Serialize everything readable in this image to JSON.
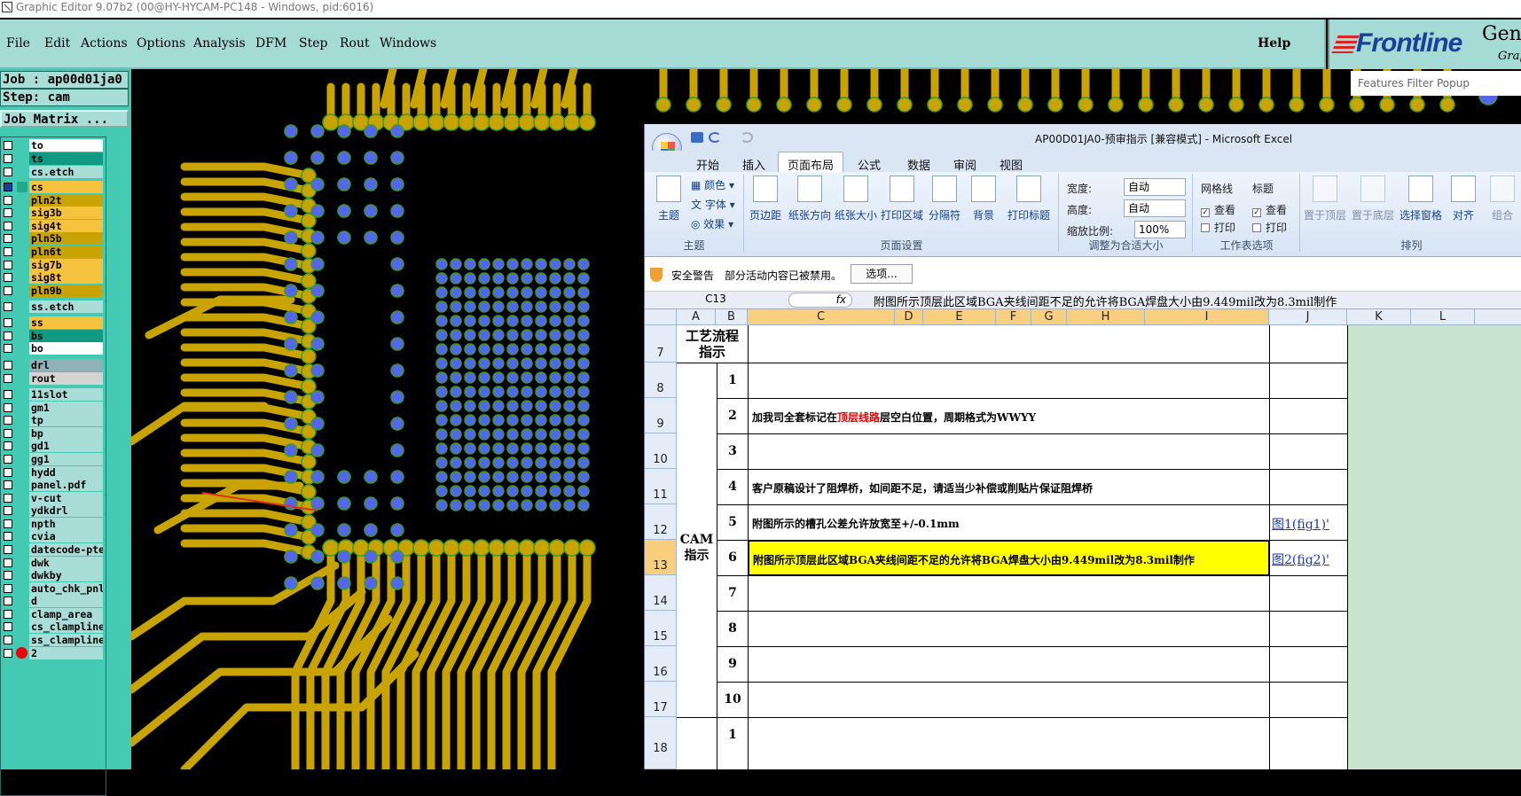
{
  "window": {
    "title": "Graphic Editor 9.07b2 (00@HY-HYCAM-PC148 - Windows, pid:6016)"
  },
  "menu": {
    "items": [
      "File",
      "Edit",
      "Actions",
      "Options",
      "Analysis",
      "DFM",
      "Step",
      "Rout",
      "Windows"
    ],
    "help": "Help"
  },
  "logo": {
    "brand": "Frontline",
    "product": "Genesis",
    "sub": "Graphic"
  },
  "job": {
    "job_label": "Job : ap00d01ja0",
    "step_label": "Step: cam",
    "matrix_button": "Job Matrix ..."
  },
  "layers": [
    {
      "name": "to",
      "color": "#ffffff",
      "checked": false
    },
    {
      "name": "ts",
      "color": "#109a83",
      "checked": false
    },
    {
      "name": "cs.etch",
      "color": "#a9ddd7",
      "checked": false
    },
    {
      "name": "cs",
      "color": "#f6c33e",
      "checked": true
    },
    {
      "name": "pln2t",
      "color": "#c9a300",
      "checked": false
    },
    {
      "name": "sig3b",
      "color": "#f6c33e",
      "checked": false
    },
    {
      "name": "sig4t",
      "color": "#f6c33e",
      "checked": false
    },
    {
      "name": "pln5b",
      "color": "#c9a300",
      "checked": false
    },
    {
      "name": "pln6t",
      "color": "#c9a300",
      "checked": false
    },
    {
      "name": "sig7b",
      "color": "#f6c33e",
      "checked": false
    },
    {
      "name": "sig8t",
      "color": "#f6c33e",
      "checked": false
    },
    {
      "name": "pln9b",
      "color": "#c9a300",
      "checked": false
    },
    {
      "name": "ss.etch",
      "color": "#a9ddd7",
      "checked": false
    },
    {
      "name": "ss",
      "color": "#f6c33e",
      "checked": false
    },
    {
      "name": "bs",
      "color": "#109a83",
      "checked": false
    },
    {
      "name": "bo",
      "color": "#ffffff",
      "checked": false
    },
    {
      "name": "drl",
      "color": "#8fb1b7",
      "checked": false
    },
    {
      "name": "rout",
      "color": "#d4d4d4",
      "checked": false
    },
    {
      "name": "11slot",
      "color": "#a9ddd7",
      "checked": false
    },
    {
      "name": "gm1",
      "color": "#a9ddd7",
      "checked": false
    },
    {
      "name": "tp",
      "color": "#a9ddd7",
      "checked": false
    },
    {
      "name": "bp",
      "color": "#a9ddd7",
      "checked": false
    },
    {
      "name": "gd1",
      "color": "#a9ddd7",
      "checked": false
    },
    {
      "name": "gg1",
      "color": "#a9ddd7",
      "checked": false
    },
    {
      "name": "hydd",
      "color": "#a9ddd7",
      "checked": false
    },
    {
      "name": "panel.pdf",
      "color": "#a9ddd7",
      "checked": false
    },
    {
      "name": "v-cut",
      "color": "#a9ddd7",
      "checked": false
    },
    {
      "name": "ydkdrl",
      "color": "#a9ddd7",
      "checked": false
    },
    {
      "name": "npth",
      "color": "#a9ddd7",
      "checked": false
    },
    {
      "name": "cvia",
      "color": "#a9ddd7",
      "checked": false
    },
    {
      "name": "datecode-pte",
      "color": "#a9ddd7",
      "checked": false
    },
    {
      "name": "dwk",
      "color": "#a9ddd7",
      "checked": false
    },
    {
      "name": "dwkby",
      "color": "#a9ddd7",
      "checked": false
    },
    {
      "name": "auto_chk_pnl",
      "color": "#a9ddd7",
      "checked": false
    },
    {
      "name": "d",
      "color": "#a9ddd7",
      "checked": false
    },
    {
      "name": "clamp_area",
      "color": "#a9ddd7",
      "checked": false
    },
    {
      "name": "cs_clampline",
      "color": "#a9ddd7",
      "checked": false
    },
    {
      "name": "ss_clampline",
      "color": "#a9ddd7",
      "checked": false
    },
    {
      "name": "2",
      "color": "#a9ddd7",
      "checked": false
    }
  ],
  "features_popup": {
    "title": "Features Filter Popup"
  },
  "excel": {
    "title": "AP00D01JA0-预审指示 [兼容模式] - Microsoft Excel",
    "tabs": [
      "开始",
      "插入",
      "页面布局",
      "公式",
      "数据",
      "审阅",
      "视图"
    ],
    "active_tab": "页面布局",
    "ribbon": {
      "theme": {
        "main": "主题",
        "colors": "颜色",
        "fonts": "字体",
        "effects": "效果",
        "group": "主题"
      },
      "page_setup": {
        "buttons": [
          "页边距",
          "纸张方向",
          "纸张大小",
          "打印区域",
          "分隔符",
          "背景",
          "打印标题"
        ],
        "group": "页面设置"
      },
      "scale": {
        "width_label": "宽度:",
        "width_value": "自动",
        "height_label": "高度:",
        "height_value": "自动",
        "scale_label": "缩放比例:",
        "scale_value": "100%",
        "group": "调整为合适大小"
      },
      "sheet_options": {
        "gridlines": "网格线",
        "headings": "标题",
        "view": "查看",
        "print": "打印",
        "group": "工作表选项"
      },
      "arrange": {
        "buttons": [
          "置于顶层",
          "置于底层",
          "选择窗格",
          "对齐",
          "组合"
        ],
        "group": "排列"
      }
    },
    "security": {
      "title": "安全警告",
      "message": "部分活动内容已被禁用。",
      "button": "选项..."
    },
    "formula_bar": {
      "cell_ref": "C13",
      "fx": "fx",
      "content": "附图所示顶层此区域BGA夹线间距不足的允许将BGA焊盘大小由9.449mil改为8.3mil制作"
    },
    "columns": [
      "A",
      "B",
      "C",
      "D",
      "E",
      "F",
      "G",
      "H",
      "I",
      "J",
      "K",
      "L"
    ],
    "row_numbers": [
      "7",
      "8",
      "9",
      "10",
      "11",
      "12",
      "13",
      "14",
      "15",
      "16",
      "17",
      "18"
    ],
    "header_a7": "工艺流程\n指示",
    "group_label": "CAM\n指示",
    "rows": [
      {
        "num": "1",
        "text": ""
      },
      {
        "num": "2",
        "text_pre": "加我司全套标记在",
        "text_red": "顶层线路",
        "text_post": "层空白位置，周期格式为WWYY"
      },
      {
        "num": "3",
        "text": ""
      },
      {
        "num": "4",
        "text": "客户原稿设计了阻焊桥，如间距不足，请适当少补偿或削贴片保证阻焊桥"
      },
      {
        "num": "5",
        "text": "附图所示的槽孔公差允许放宽至+/-0.1mm",
        "link": "图1(fig1)'"
      },
      {
        "num": "6",
        "text": "附图所示顶层此区域BGA夹线间距不足的允许将BGA焊盘大小由9.449mil改为8.3mil制作",
        "link": "图2(fig2)'"
      },
      {
        "num": "7",
        "text": ""
      },
      {
        "num": "8",
        "text": ""
      },
      {
        "num": "9",
        "text": ""
      },
      {
        "num": "10",
        "text": ""
      }
    ],
    "next_row_num": "1"
  }
}
